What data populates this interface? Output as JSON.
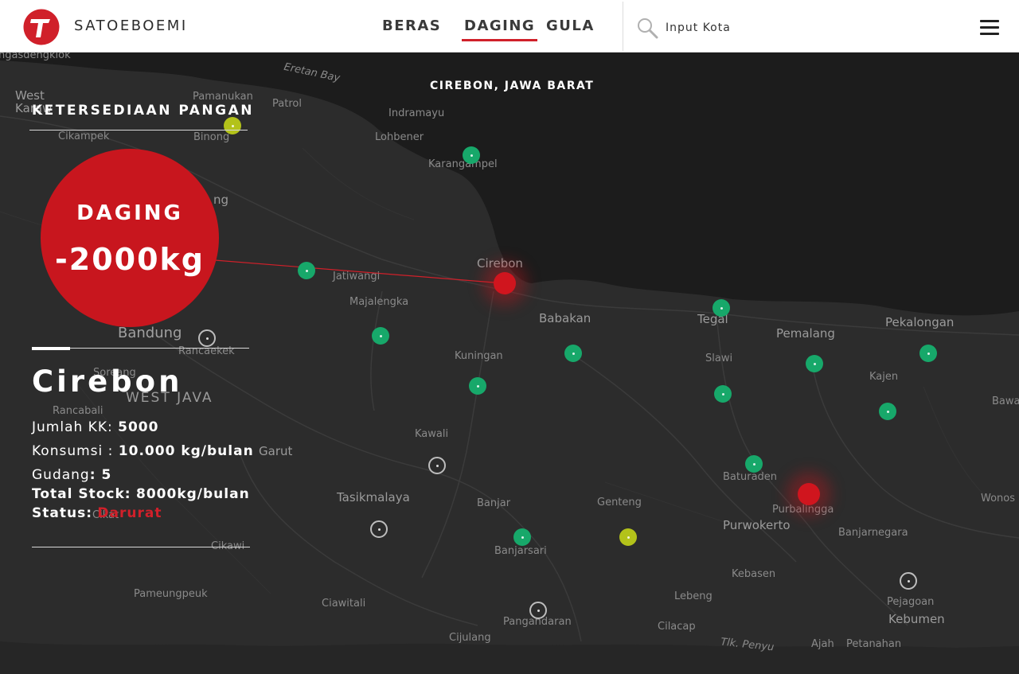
{
  "header": {
    "brand": "SATOEBOEMI",
    "tabs": [
      {
        "label": "BERAS",
        "active": false
      },
      {
        "label": "DAGING",
        "active": true
      },
      {
        "label": "GULA",
        "active": false
      }
    ],
    "search_placeholder": "Input Kota",
    "accent_color": "#d0202a"
  },
  "map": {
    "region_title": "CIREBON, JAWA BARAT",
    "places": {
      "gasdengklok": "ngasdengklok",
      "west_karawang": "West Karaw",
      "pamanukan": "Pamanukan",
      "patrol": "Patrol",
      "eretan_bay": "Eretan Bay",
      "indramayu": "Indramayu",
      "lohbener": "Lohbener",
      "cikampek": "Cikampek",
      "binong": "Binong",
      "karangampel": "Karangampel",
      "ng": "ng",
      "cirebon": "Cirebon",
      "jatiwangi": "Jatiwangi",
      "majalengka": "Majalengka",
      "bandung": "Bandung",
      "rancaekek": "Rancaekek",
      "babakan": "Babakan",
      "tegal": "Tegal",
      "pemalang": "Pemalang",
      "pekalongan": "Pekalongan",
      "kuningan": "Kuningan",
      "slawi": "Slawi",
      "soreang": "Soreang",
      "west_java": "WEST JAVA",
      "kajen": "Kajen",
      "bawa": "Bawa",
      "rancabali": "Rancabali",
      "kawali": "Kawali",
      "garut": "Garut",
      "tasikmalaya": "Tasikmalaya",
      "banjar": "Banjar",
      "genteng": "Genteng",
      "baturaden": "Baturaden",
      "purbalingga": "Purbalingga",
      "wonos": "Wonos",
      "purwokerto": "Purwokerto",
      "banjarnegara": "Banjarnegara",
      "cikatomas": "Cikat",
      "banjarsari": "Banjarsari",
      "cikawi": "Cikawi",
      "kebasen": "Kebasen",
      "pameungpeuk": "Pameungpeuk",
      "ciawitali": "Ciawitali",
      "lebeng": "Lebeng",
      "pejagoan": "Pejagoan",
      "kebumen": "Kebumen",
      "pangandaran": "Pangandaran",
      "cilacap": "Cilacap",
      "cijulang": "Cijulang",
      "tlk_penyu": "Tlk. Penyu",
      "ajah": "Ajah",
      "petanahan": "Petanahan"
    },
    "marker_colors": {
      "green": "#17a86a",
      "yellow": "#b3c21a",
      "gray": "#bdbdbd",
      "red": "#d0151e"
    }
  },
  "panel": {
    "title": "KETERSEDIAAN PANGAN",
    "bubble_category": "DAGING",
    "bubble_value": "-2000kg",
    "city": "Cirebon",
    "kk_label": "Jumlah KK:",
    "kk_value": "5000",
    "konsumsi_label": "Konsumsi :",
    "konsumsi_value": "10.000 kg/bulan",
    "gudang_label": "Gudang",
    "gudang_value": ": 5",
    "stock_label": "Total Stock:",
    "stock_value": "8000kg/bulan",
    "status_label": "Status:",
    "status_value": "Darurat",
    "status_color": "#d0202a"
  }
}
